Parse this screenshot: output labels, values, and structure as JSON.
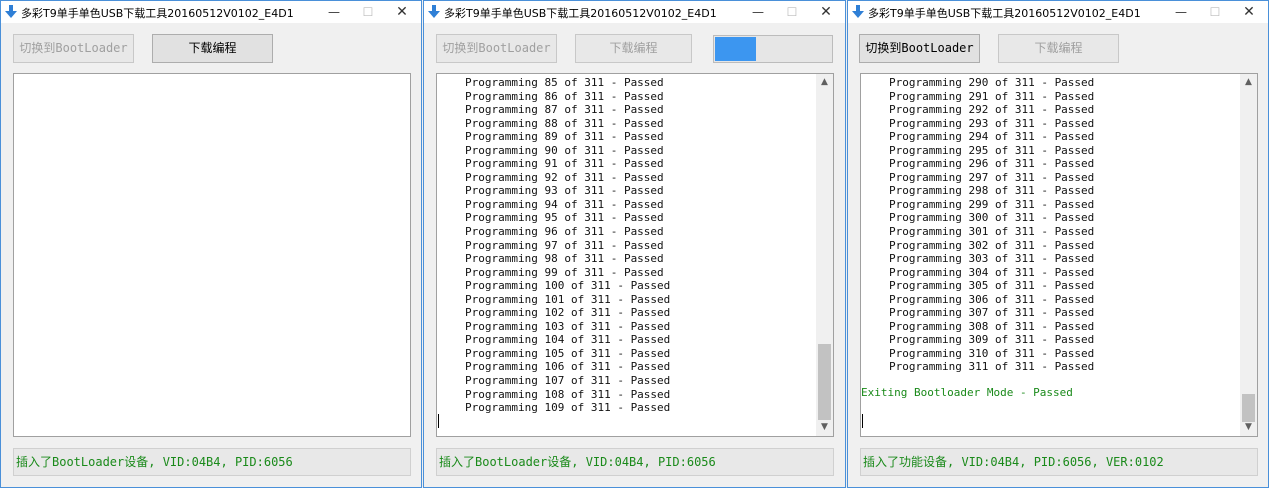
{
  "windows": [
    {
      "title": "多彩T9单手单色USB下载工具20160512V0102_E4D1",
      "btn_bootloader": "切换到BootLoader",
      "btn_download": "下载编程",
      "status": "插入了BootLoader设备, VID:04B4, PID:6056"
    },
    {
      "title": "多彩T9单手单色USB下载工具20160512V0102_E4D1",
      "btn_bootloader": "切换到BootLoader",
      "btn_download": "下载编程",
      "progress_fraction": 0.35,
      "log_text": "Programming 85 of 311 - Passed\nProgramming 86 of 311 - Passed\nProgramming 87 of 311 - Passed\nProgramming 88 of 311 - Passed\nProgramming 89 of 311 - Passed\nProgramming 90 of 311 - Passed\nProgramming 91 of 311 - Passed\nProgramming 92 of 311 - Passed\nProgramming 93 of 311 - Passed\nProgramming 94 of 311 - Passed\nProgramming 95 of 311 - Passed\nProgramming 96 of 311 - Passed\nProgramming 97 of 311 - Passed\nProgramming 98 of 311 - Passed\nProgramming 99 of 311 - Passed\nProgramming 100 of 311 - Passed\nProgramming 101 of 311 - Passed\nProgramming 102 of 311 - Passed\nProgramming 103 of 311 - Passed\nProgramming 104 of 311 - Passed\nProgramming 105 of 311 - Passed\nProgramming 106 of 311 - Passed\nProgramming 107 of 311 - Passed\nProgramming 108 of 311 - Passed\nProgramming 109 of 311 - Passed",
      "status": "插入了BootLoader设备, VID:04B4, PID:6056"
    },
    {
      "title": "多彩T9单手单色USB下载工具20160512V0102_E4D1",
      "btn_bootloader": "切换到BootLoader",
      "btn_download": "下载编程",
      "log_text": "Programming 290 of 311 - Passed\nProgramming 291 of 311 - Passed\nProgramming 292 of 311 - Passed\nProgramming 293 of 311 - Passed\nProgramming 294 of 311 - Passed\nProgramming 295 of 311 - Passed\nProgramming 296 of 311 - Passed\nProgramming 297 of 311 - Passed\nProgramming 298 of 311 - Passed\nProgramming 299 of 311 - Passed\nProgramming 300 of 311 - Passed\nProgramming 301 of 311 - Passed\nProgramming 302 of 311 - Passed\nProgramming 303 of 311 - Passed\nProgramming 304 of 311 - Passed\nProgramming 305 of 311 - Passed\nProgramming 306 of 311 - Passed\nProgramming 307 of 311 - Passed\nProgramming 308 of 311 - Passed\nProgramming 309 of 311 - Passed\nProgramming 310 of 311 - Passed\nProgramming 311 of 311 - Passed",
      "log_exit": "Exiting Bootloader Mode - Passed",
      "status": "插入了功能设备, VID:04B4, PID:6056, VER:0102"
    }
  ],
  "titlebar": {
    "minimize": "—",
    "maximize": "☐",
    "close": "✕"
  },
  "scrollbar": {
    "up": "▲",
    "down": "▼"
  },
  "colors": {
    "accent": "#3c96f0",
    "status_green": "#1a8a1a",
    "window_border": "#4a90d9"
  },
  "icons": {
    "app": "download-arrow-icon"
  }
}
